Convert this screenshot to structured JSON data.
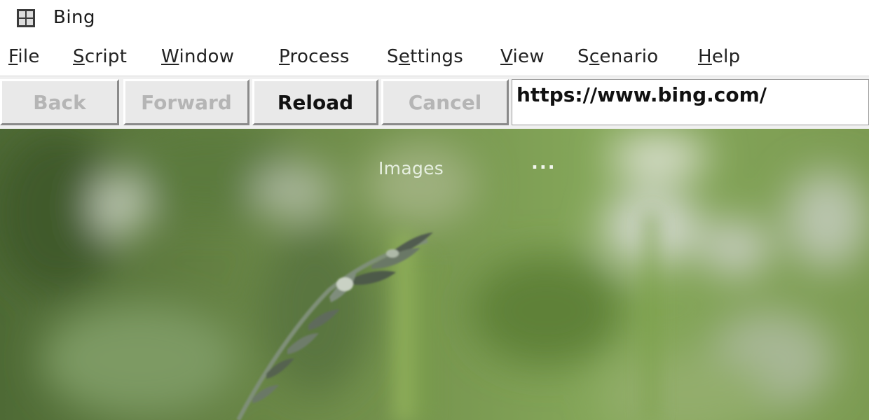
{
  "window": {
    "title": "Bing",
    "icon": "app-grid-icon"
  },
  "menu": [
    {
      "mnemonic": "F",
      "rest": "ile"
    },
    {
      "mnemonic": "S",
      "rest": "cript"
    },
    {
      "mnemonic": "W",
      "rest": "indow"
    },
    {
      "mnemonic": "P",
      "rest": "rocess"
    },
    {
      "pre": "S",
      "mnemonic": "e",
      "rest": "ttings"
    },
    {
      "mnemonic": "V",
      "rest": "iew"
    },
    {
      "pre": "S",
      "mnemonic": "c",
      "rest": "enario"
    },
    {
      "mnemonic": "H",
      "rest": "elp"
    }
  ],
  "toolbar": {
    "back_label": "Back",
    "forward_label": "Forward",
    "reload_label": "Reload",
    "cancel_label": "Cancel",
    "url": "https://www.bing.com/"
  },
  "page": {
    "nav_images": "Images",
    "nav_more": "...",
    "background": "blurred green meadow with grass seed head"
  },
  "colors": {
    "toolbar_bg": "#f0f0f0",
    "disabled_text": "#b5b5b5",
    "meadow_green": "#6f8f4a"
  }
}
